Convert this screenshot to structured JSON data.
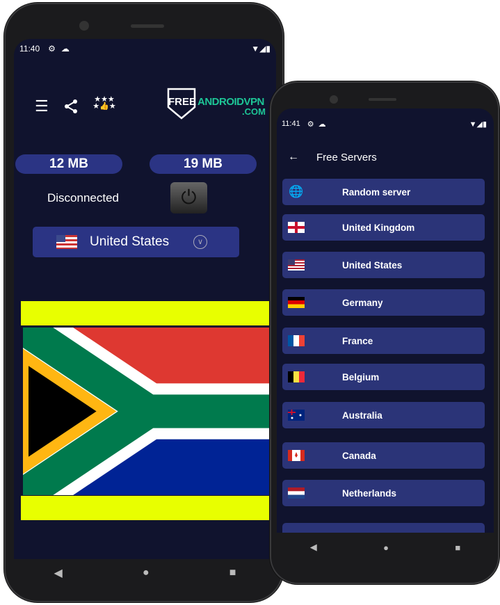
{
  "main_phone": {
    "status": {
      "time": "11:40"
    },
    "logo": {
      "text_free": "FREE",
      "text_android": "ANDROIDVPN",
      "text_com": ".COM"
    },
    "toolbar": {
      "icons": [
        "list-icon",
        "share-icon",
        "rate-icon"
      ]
    },
    "download": "12 MB",
    "upload": "19 MB",
    "connection_status": "Disconnected",
    "selected_country": "United States",
    "banner_flag": "South Africa",
    "colors": {
      "background": "#10132e",
      "pill": "#2b3484",
      "banner": "#e8ff00"
    }
  },
  "server_phone": {
    "status": {
      "time": "11:41"
    },
    "title": "Free Servers",
    "servers": [
      {
        "label": "Random server",
        "icon": "globe"
      },
      {
        "label": "United Kingdom",
        "icon": "flag-england"
      },
      {
        "label": "United States",
        "icon": "flag-us"
      },
      {
        "label": "Germany",
        "icon": "flag-de"
      },
      {
        "label": "France",
        "icon": "flag-fr"
      },
      {
        "label": "Belgium",
        "icon": "flag-be"
      },
      {
        "label": "Australia",
        "icon": "flag-au"
      },
      {
        "label": "Canada",
        "icon": "flag-ca"
      },
      {
        "label": "Netherlands",
        "icon": "flag-nl"
      }
    ]
  }
}
